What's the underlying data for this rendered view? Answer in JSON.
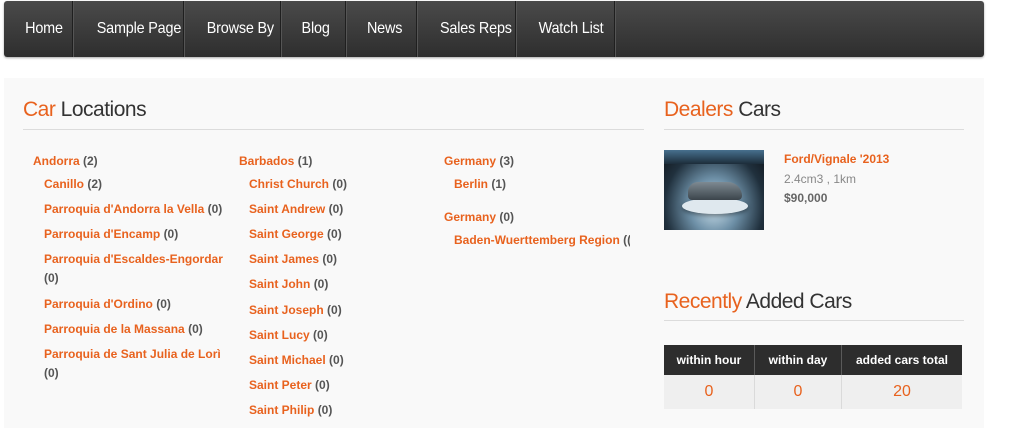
{
  "nav": {
    "items": [
      "Home",
      "Sample Page",
      "Browse By",
      "Blog",
      "News",
      "Sales Reps",
      "Watch List"
    ]
  },
  "car_locations": {
    "title_accent": "Car",
    "title_rest": " Locations",
    "col1": {
      "country": "Andorra",
      "country_count": "(2)",
      "items": [
        {
          "name": "Canillo",
          "count": "(2)"
        },
        {
          "name": "Parroquia d'Andorra la Vella",
          "count": "(0)"
        },
        {
          "name": "Parroquia d'Encamp",
          "count": "(0)"
        },
        {
          "name": "Parroquia d'Escaldes-Engordar",
          "count": "(0)"
        },
        {
          "name": "Parroquia d'Ordino",
          "count": "(0)"
        },
        {
          "name": "Parroquia de la Massana",
          "count": "(0)"
        },
        {
          "name": "Parroquia de Sant Julia de Lorì",
          "count": "(0)"
        }
      ]
    },
    "col2": {
      "country": "Barbados",
      "country_count": "(1)",
      "items": [
        {
          "name": "Christ Church",
          "count": "(0)"
        },
        {
          "name": "Saint Andrew",
          "count": "(0)"
        },
        {
          "name": "Saint George",
          "count": "(0)"
        },
        {
          "name": "Saint James",
          "count": "(0)"
        },
        {
          "name": "Saint John",
          "count": "(0)"
        },
        {
          "name": "Saint Joseph",
          "count": "(0)"
        },
        {
          "name": "Saint Lucy",
          "count": "(0)"
        },
        {
          "name": "Saint Michael",
          "count": "(0)"
        },
        {
          "name": "Saint Peter",
          "count": "(0)"
        },
        {
          "name": "Saint Philip",
          "count": "(0)"
        }
      ]
    },
    "col3": {
      "country1": "Germany",
      "country1_count": "(3)",
      "item1": {
        "name": "Berlin",
        "count": "(1)"
      },
      "country2": "Germany",
      "country2_count": "(0)",
      "item2": {
        "name": "Baden-Wuerttemberg Region",
        "count": "(("
      }
    }
  },
  "dealers_cars": {
    "title_accent": "Dealers",
    "title_rest": " Cars",
    "car": {
      "title": "Ford/Vignale '2013",
      "spec": "2.4cm3 , 1km",
      "price": "$90,000"
    }
  },
  "recently": {
    "title_accent": "Recently",
    "title_rest": " Added Cars",
    "headers": [
      "within hour",
      "within day",
      "added cars total"
    ],
    "values": [
      "0",
      "0",
      "20"
    ]
  },
  "colors": {
    "accent": "#e8621e",
    "nav": "#3a3a3a"
  }
}
